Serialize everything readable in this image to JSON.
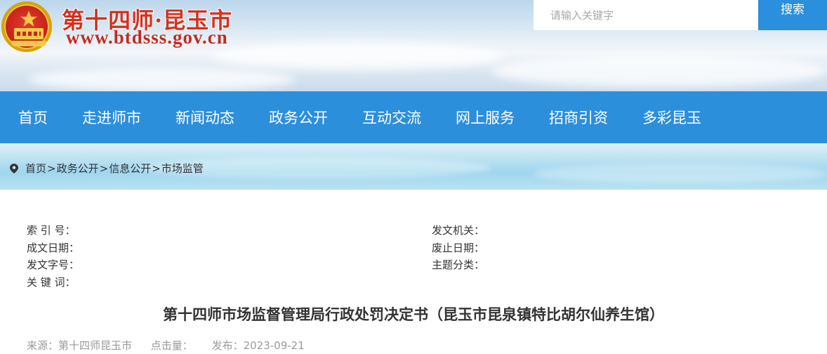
{
  "header": {
    "site_title": "第十四师·昆玉市",
    "site_url": "www.btdsss.gov.cn",
    "emblem_icon": "national-emblem-icon"
  },
  "search": {
    "placeholder": "请输入关键字",
    "button_label": "搜索"
  },
  "nav": {
    "items": [
      {
        "label": "首页"
      },
      {
        "label": "走进师市"
      },
      {
        "label": "新闻动态"
      },
      {
        "label": "政务公开"
      },
      {
        "label": "互动交流"
      },
      {
        "label": "网上服务"
      },
      {
        "label": "招商引资"
      },
      {
        "label": "多彩昆玉"
      }
    ]
  },
  "breadcrumb": {
    "icon": "location-pin-icon",
    "separator": ">",
    "items": [
      {
        "label": "首页"
      },
      {
        "label": "政务公开"
      },
      {
        "label": "信息公开"
      },
      {
        "label": "市场监管"
      }
    ]
  },
  "meta": {
    "left": [
      {
        "label": "索 引 号："
      },
      {
        "label": "成文日期："
      },
      {
        "label": "发文字号："
      },
      {
        "label": "关 键 词："
      }
    ],
    "right": [
      {
        "label": "发文机关："
      },
      {
        "label": "废止日期："
      },
      {
        "label": "主题分类："
      }
    ]
  },
  "article": {
    "title": "第十四师市场监督管理局行政处罚决定书（昆玉市昆泉镇特比胡尔仙养生馆）",
    "source": "来源：第十四师昆玉市",
    "views": "点击量：",
    "published": "发布：2023-09-21"
  },
  "colors": {
    "nav_bg": "#2c8fdb",
    "search_button": "#2a8fdc",
    "title_red": "#d2321f"
  }
}
